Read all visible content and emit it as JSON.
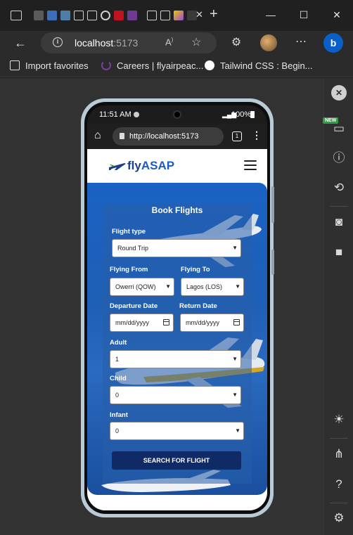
{
  "browser": {
    "address": {
      "host": "localhost",
      "port": ":5173"
    },
    "favorites": [
      {
        "label": "Import favorites"
      },
      {
        "label": "Careers | flyairpeac..."
      },
      {
        "label": "Tailwind CSS : Begin..."
      }
    ],
    "sidebar": {
      "new_badge": "NEW"
    }
  },
  "phone": {
    "status": {
      "time": "11:51 AM",
      "battery": "100%"
    },
    "url": "http://localhost:5173",
    "tab_count": "1",
    "site": {
      "logo": {
        "fly": "fly",
        "asap": "ASAP"
      },
      "form": {
        "title": "Book Flights",
        "flight_type": {
          "label": "Flight type",
          "value": "Round Trip"
        },
        "flying_from": {
          "label": "Flying From",
          "value": "Owerri (QOW)"
        },
        "flying_to": {
          "label": "Flying To",
          "value": "Lagos (LOS)"
        },
        "departure_date": {
          "label": "Departure Date",
          "placeholder": "mm/dd/yyyy"
        },
        "return_date": {
          "label": "Return Date",
          "placeholder": "mm/dd/yyyy"
        },
        "adult": {
          "label": "Adult",
          "value": "1"
        },
        "child": {
          "label": "Child",
          "value": "0"
        },
        "infant": {
          "label": "Infant",
          "value": "0"
        },
        "submit": "SEARCH FOR FLIGHT"
      }
    }
  }
}
